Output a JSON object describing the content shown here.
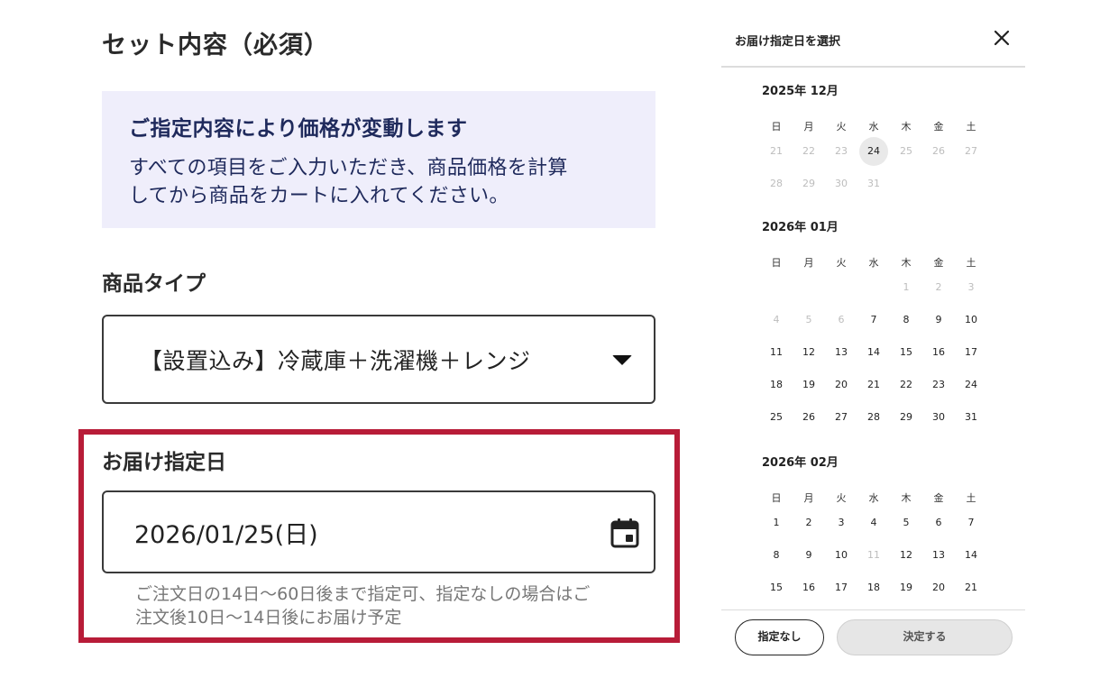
{
  "form": {
    "section_title": "セット内容（必須）",
    "notice": {
      "title": "ご指定内容により価格が変動します",
      "line1": "すべての項目をご入力いただき、商品価格を計算",
      "line2": "してから商品をカートに入れてください。",
      "background_color": "#efeefb",
      "text_color": "#1f2a5c"
    },
    "product_type": {
      "label": "商品タイプ",
      "selected": "【設置込み】冷蔵庫＋洗濯機＋レンジ"
    },
    "delivery_date": {
      "label": "お届け指定日",
      "value": "2026/01/25(日)",
      "help_line1": "ご注文日の14日〜60日後まで指定可、指定なしの場合はご",
      "help_line2": "注文後10日〜14日後にお届け予定"
    },
    "highlight_color": "#b81c38"
  },
  "panel": {
    "title": "お届け指定日を選択",
    "close_icon": "close-icon",
    "weekdays": [
      "日",
      "月",
      "火",
      "水",
      "木",
      "金",
      "土"
    ],
    "months": [
      {
        "label": "2025年 12月",
        "weeks": [
          [
            {
              "d": "21",
              "s": "disabled"
            },
            {
              "d": "22",
              "s": "disabled"
            },
            {
              "d": "23",
              "s": "disabled"
            },
            {
              "d": "24",
              "s": "today"
            },
            {
              "d": "25",
              "s": "disabled"
            },
            {
              "d": "26",
              "s": "disabled"
            },
            {
              "d": "27",
              "s": "disabled"
            }
          ],
          [
            {
              "d": "28",
              "s": "disabled"
            },
            {
              "d": "29",
              "s": "disabled"
            },
            {
              "d": "30",
              "s": "disabled"
            },
            {
              "d": "31",
              "s": "disabled"
            },
            null,
            null,
            null
          ]
        ]
      },
      {
        "label": "2026年 01月",
        "weeks": [
          [
            null,
            null,
            null,
            null,
            {
              "d": "1",
              "s": "disabled"
            },
            {
              "d": "2",
              "s": "disabled"
            },
            {
              "d": "3",
              "s": "disabled"
            }
          ],
          [
            {
              "d": "4",
              "s": "disabled"
            },
            {
              "d": "5",
              "s": "disabled"
            },
            {
              "d": "6",
              "s": "disabled"
            },
            {
              "d": "7",
              "s": "enabled"
            },
            {
              "d": "8",
              "s": "enabled"
            },
            {
              "d": "9",
              "s": "enabled"
            },
            {
              "d": "10",
              "s": "enabled"
            }
          ],
          [
            {
              "d": "11",
              "s": "enabled"
            },
            {
              "d": "12",
              "s": "enabled"
            },
            {
              "d": "13",
              "s": "enabled"
            },
            {
              "d": "14",
              "s": "enabled"
            },
            {
              "d": "15",
              "s": "enabled"
            },
            {
              "d": "16",
              "s": "enabled"
            },
            {
              "d": "17",
              "s": "enabled"
            }
          ],
          [
            {
              "d": "18",
              "s": "enabled"
            },
            {
              "d": "19",
              "s": "enabled"
            },
            {
              "d": "20",
              "s": "enabled"
            },
            {
              "d": "21",
              "s": "enabled"
            },
            {
              "d": "22",
              "s": "enabled"
            },
            {
              "d": "23",
              "s": "enabled"
            },
            {
              "d": "24",
              "s": "enabled"
            }
          ],
          [
            {
              "d": "25",
              "s": "enabled"
            },
            {
              "d": "26",
              "s": "enabled"
            },
            {
              "d": "27",
              "s": "enabled"
            },
            {
              "d": "28",
              "s": "enabled"
            },
            {
              "d": "29",
              "s": "enabled"
            },
            {
              "d": "30",
              "s": "enabled"
            },
            {
              "d": "31",
              "s": "enabled"
            }
          ]
        ]
      },
      {
        "label": "2026年 02月",
        "weeks": [
          [
            {
              "d": "1",
              "s": "enabled"
            },
            {
              "d": "2",
              "s": "enabled"
            },
            {
              "d": "3",
              "s": "enabled"
            },
            {
              "d": "4",
              "s": "enabled"
            },
            {
              "d": "5",
              "s": "enabled"
            },
            {
              "d": "6",
              "s": "enabled"
            },
            {
              "d": "7",
              "s": "enabled"
            }
          ],
          [
            {
              "d": "8",
              "s": "enabled"
            },
            {
              "d": "9",
              "s": "enabled"
            },
            {
              "d": "10",
              "s": "enabled"
            },
            {
              "d": "11",
              "s": "disabled"
            },
            {
              "d": "12",
              "s": "enabled"
            },
            {
              "d": "13",
              "s": "enabled"
            },
            {
              "d": "14",
              "s": "enabled"
            }
          ],
          [
            {
              "d": "15",
              "s": "enabled"
            },
            {
              "d": "16",
              "s": "enabled"
            },
            {
              "d": "17",
              "s": "enabled"
            },
            {
              "d": "18",
              "s": "enabled"
            },
            {
              "d": "19",
              "s": "enabled"
            },
            {
              "d": "20",
              "s": "enabled"
            },
            {
              "d": "21",
              "s": "enabled"
            }
          ]
        ]
      }
    ],
    "buttons": {
      "none_label": "指定なし",
      "confirm_label": "決定する"
    }
  }
}
